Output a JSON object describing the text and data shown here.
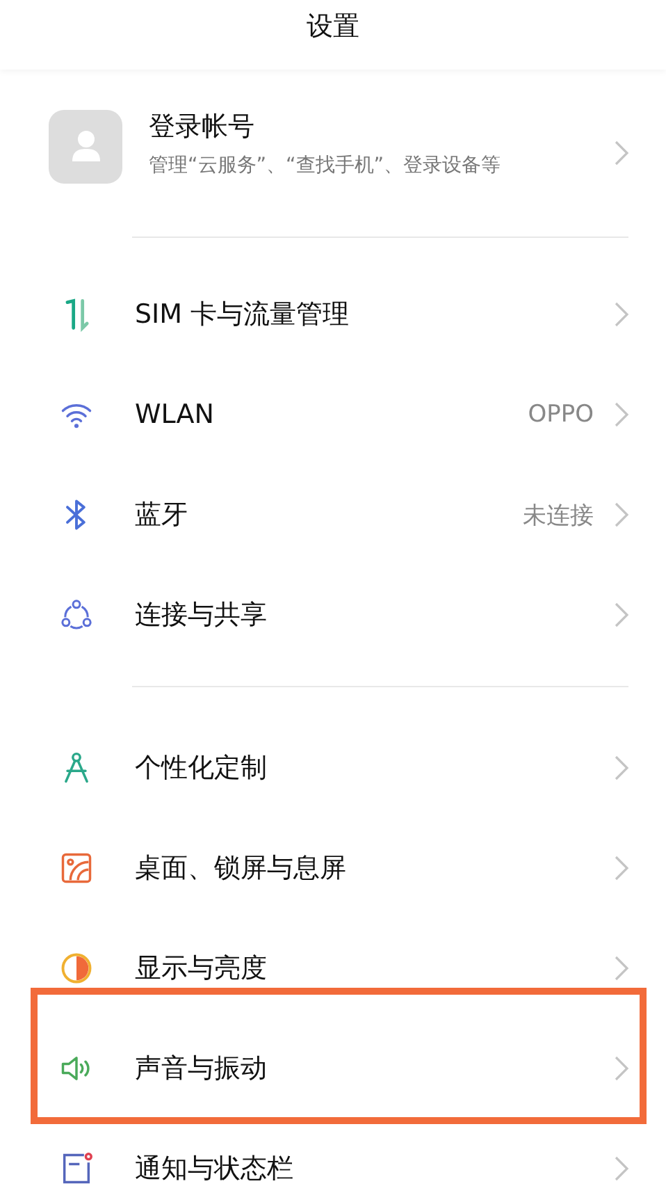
{
  "header": {
    "title": "设置"
  },
  "account": {
    "title": "登录帐号",
    "subtitle": "管理“云服务”、“查找手机”、登录设备等"
  },
  "groups": [
    {
      "items": [
        {
          "label": "SIM 卡与流量管理",
          "highlighted": false
        },
        {
          "label": "WLAN",
          "value": "OPPO",
          "highlighted": false
        },
        {
          "label": "蓝牙",
          "value": "未连接",
          "highlighted": false
        },
        {
          "label": "连接与共享",
          "highlighted": false
        }
      ]
    },
    {
      "items": [
        {
          "label": "个性化定制",
          "highlighted": false
        },
        {
          "label": "桌面、锁屏与息屏",
          "highlighted": false
        },
        {
          "label": "显示与亮度",
          "highlighted": false
        },
        {
          "label": "声音与振动",
          "highlighted": true
        },
        {
          "label": "通知与状态栏",
          "highlighted": false
        }
      ]
    }
  ]
}
